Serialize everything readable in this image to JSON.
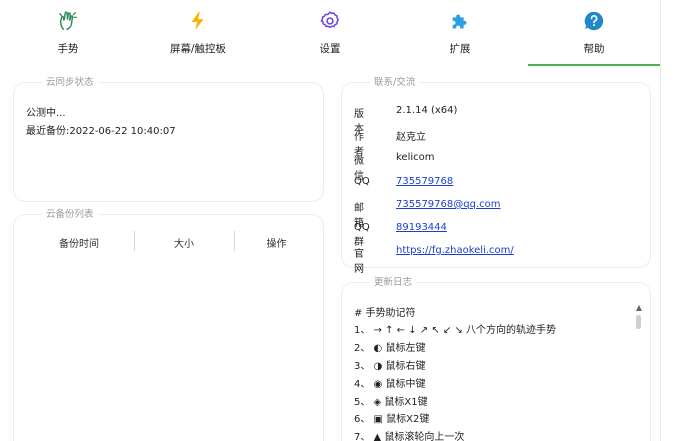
{
  "tabs": [
    {
      "label": "手势",
      "icon": "hand-gesture-icon",
      "active": false
    },
    {
      "label": "屏幕/触控板",
      "icon": "lightning-icon",
      "active": false
    },
    {
      "label": "设置",
      "icon": "gear-icon",
      "active": false
    },
    {
      "label": "扩展",
      "icon": "puzzle-icon",
      "active": false
    },
    {
      "label": "帮助",
      "icon": "help-icon",
      "active": true
    }
  ],
  "colors": {
    "accent": "#4caf50",
    "link": "#1a3fd1",
    "settings_purple": "#6a3de8",
    "extension_blue": "#2aa0e0",
    "help_blue": "#1e88c8",
    "bolt_yellow": "#f5b400"
  },
  "cloud_sync": {
    "title": "云同步状态",
    "status": "公测中...",
    "last_backup": "最近备份:2022-06-22 10:40:07"
  },
  "backup_list": {
    "title": "云备份列表",
    "columns": [
      "备份时间",
      "大小",
      "操作"
    ]
  },
  "contact": {
    "title": "联系/交流",
    "rows": [
      {
        "key": "版本",
        "value": "2.1.14 (x64)",
        "link": false
      },
      {
        "key": "作者",
        "value": "赵克立",
        "link": false
      },
      {
        "key": "微信",
        "value": "kelicom",
        "link": false
      },
      {
        "key": "QQ",
        "value": " 735579768 ",
        "link": true
      },
      {
        "key": "邮箱",
        "value": " 735579768@qq.com ",
        "link": true
      },
      {
        "key": "QQ群",
        "value": " 89193444 ",
        "link": true
      },
      {
        "key": "官网",
        "value": " https://fg.zhaokeli.com/ ",
        "link": true
      }
    ]
  },
  "changelog": {
    "title": "更新日志",
    "lines": [
      "# 手势助记符",
      "1、 → ↑ ← ↓ ↗ ↖ ↙ ↘ 八个方向的轨迹手势",
      "2、 ◐ 鼠标左键",
      "3、 ◑ 鼠标右键",
      "4、 ◉ 鼠标中键",
      "5、 ◈ 鼠标X1键",
      "6、 ▣ 鼠标X2键",
      "7、 ▲ 鼠标滚轮向上一次"
    ]
  }
}
